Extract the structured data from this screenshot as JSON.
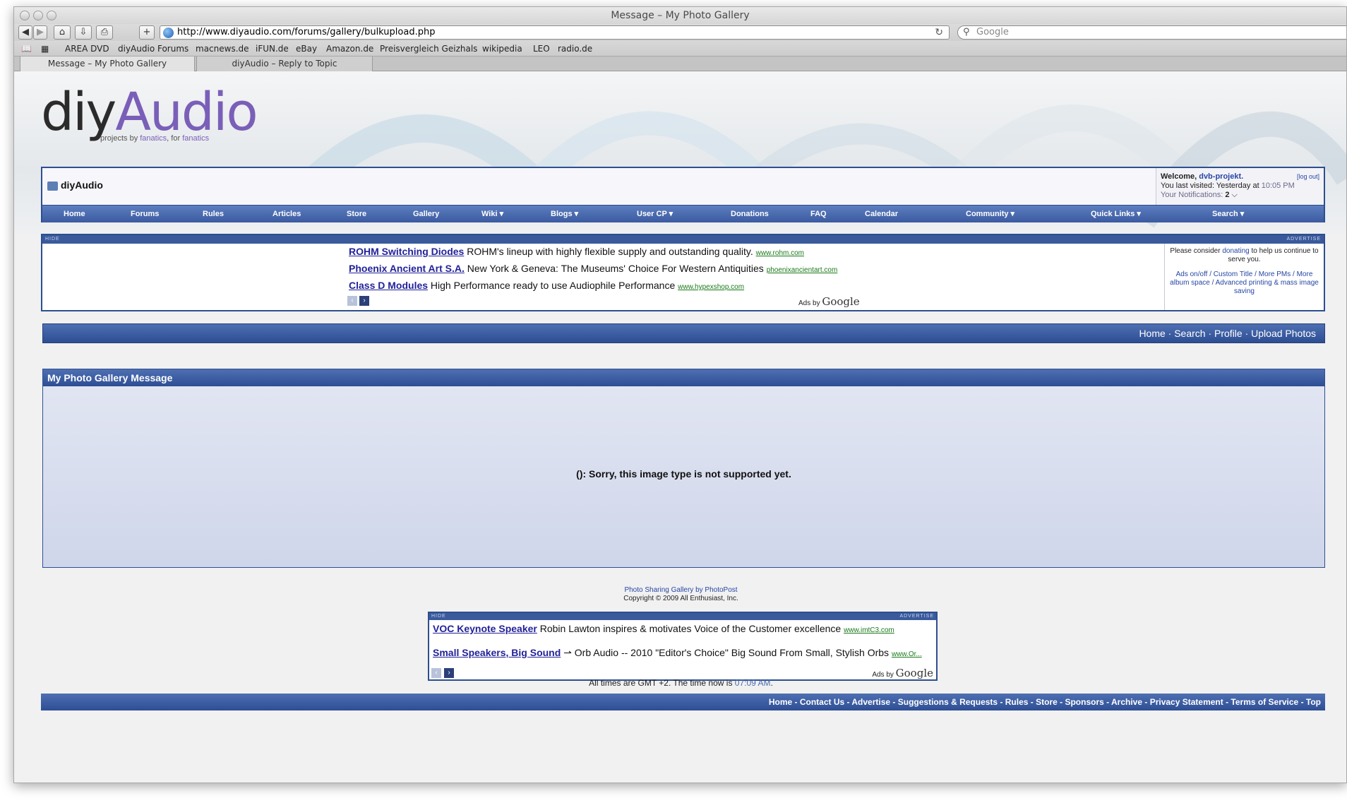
{
  "browser": {
    "window_title": "Message – My Photo Gallery",
    "url": "http://www.diyaudio.com/forums/gallery/bulkupload.php",
    "search_placeholder": "Google",
    "bookmarks": [
      "AREA DVD",
      "diyAudio Forums",
      "macnews.de",
      "iFUN.de",
      "eBay",
      "Amazon.de",
      "Preisvergleich Geizhals",
      "wikipedia",
      "LEO",
      "radio.de"
    ],
    "tabs": [
      {
        "label": "Message – My Photo Gallery",
        "active": true
      },
      {
        "label": "diyAudio – Reply to Topic",
        "active": false
      }
    ]
  },
  "logo": {
    "part1": "diy",
    "part2": "Audio",
    "tag_prefix": "projects by ",
    "tag_word1": "fanatics",
    "tag_mid": ", for ",
    "tag_word2": "fanatics"
  },
  "header": {
    "site_name": "diyAudio",
    "welcome_prefix": "Welcome, ",
    "username": "dvb-projekt.",
    "logout": "[log out]",
    "last_visited_label": "You last visited: Yesterday at ",
    "last_visited_time": "10:05 PM",
    "notifications_label": "Your Notifications: ",
    "notifications_count": "2"
  },
  "navmenu": [
    "Home",
    "Forums",
    "Rules",
    "Articles",
    "Store",
    "Gallery",
    "Wiki ▾",
    "Blogs ▾",
    "User CP ▾",
    "Donations",
    "FAQ",
    "Calendar",
    "Community ▾",
    "Quick Links ▾",
    "Search ▾"
  ],
  "top_ads": {
    "hide_label": "HIDE",
    "advert_label": "ADVERTISE",
    "items": [
      {
        "title": "ROHM Switching Diodes",
        "text": "ROHM's lineup with highly flexible supply and outstanding quality.",
        "url": "www.rohm.com"
      },
      {
        "title": "Phoenix Ancient Art S.A.",
        "text": "New York & Geneva: The Museums' Choice For Western Antiquities",
        "url": "phoenixancientart.com"
      },
      {
        "title": "Class D Modules",
        "text": "High Performance ready to use Audiophile Performance",
        "url": "www.hypexshop.com"
      }
    ],
    "ads_by": "Ads by",
    "google": "Google",
    "side_prefix": "Please consider ",
    "side_link": "donating",
    "side_suffix": " to help us continue to serve you.",
    "side_links": "Ads on/off / Custom Title / More PMs / More album space / Advanced printing & mass image saving"
  },
  "subnav": "Home · Search · Profile · Upload Photos",
  "message_panel": {
    "title": "My Photo Gallery Message",
    "text": "(): Sorry, this image type is not supported yet."
  },
  "footer": {
    "credit_link": "Photo Sharing Gallery by PhotoPost",
    "copyright": "Copyright © 2009 All Enthusiast, Inc.",
    "time_prefix": "All times are GMT +2. The time now is ",
    "time_value": "07:09 AM",
    "time_suffix": ".",
    "links": "Home - Contact Us - Advertise - Suggestions & Requests - Rules - Store - Sponsors - Archive - Privacy Statement - Terms of Service - Top"
  },
  "bottom_ads": {
    "items": [
      {
        "title": "VOC Keynote Speaker",
        "text": "Robin Lawton inspires & motivates Voice of the Customer excellence",
        "url": "www.imtC3.com"
      },
      {
        "title": "Small Speakers, Big Sound",
        "text": "Orb Audio -- 2010 \"Editor's Choice\" Big Sound From Small, Stylish Orbs",
        "url": "www.Or..."
      }
    ]
  }
}
